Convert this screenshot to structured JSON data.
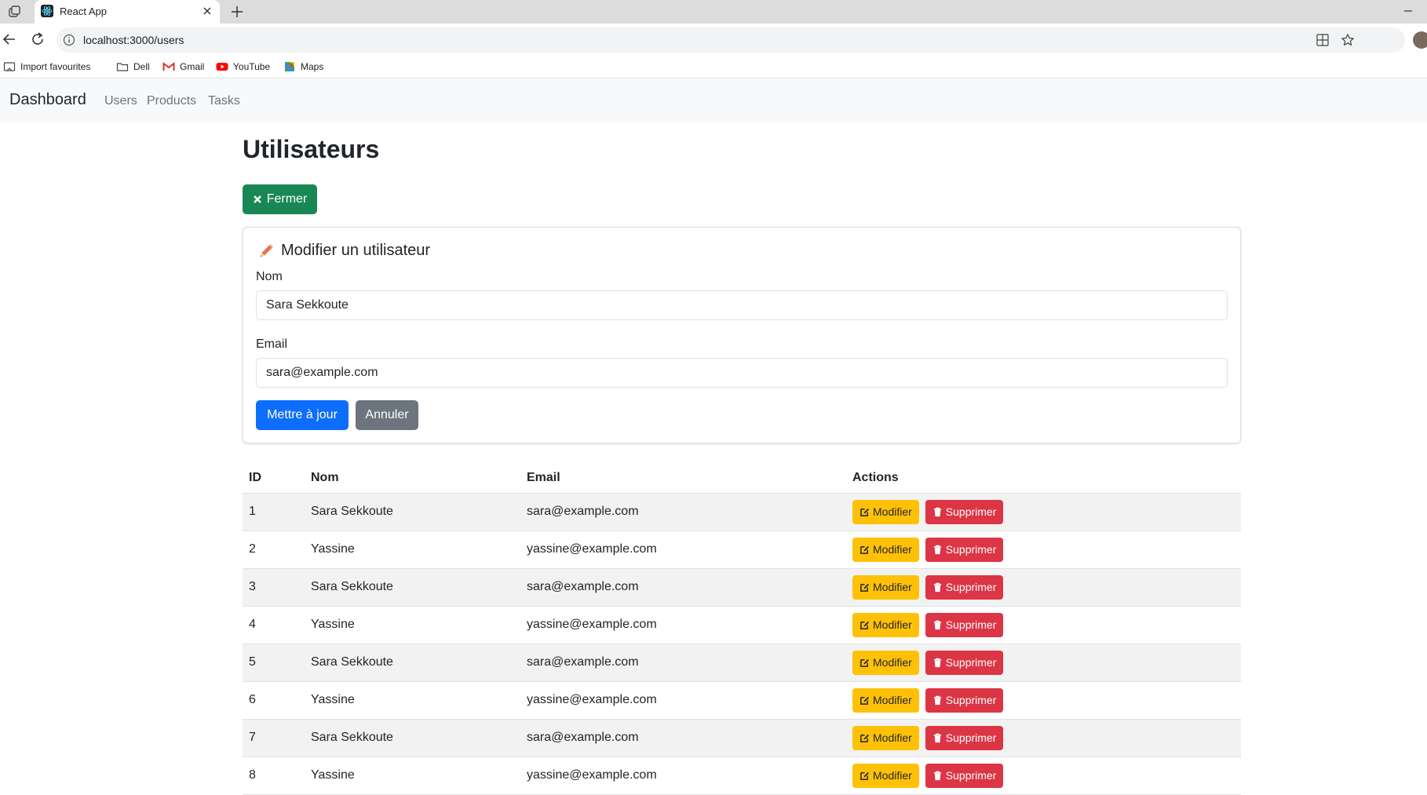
{
  "browser": {
    "tab_title": "React App",
    "url": "localhost:3000/users",
    "bookmarks": [
      "Import favourites",
      "Dell",
      "Gmail",
      "YouTube",
      "Maps"
    ]
  },
  "navbar": {
    "brand": "Dashboard",
    "links": [
      "Users",
      "Products",
      "Tasks"
    ]
  },
  "page": {
    "title": "Utilisateurs",
    "close_button": "Fermer"
  },
  "form": {
    "title": "Modifier un utilisateur",
    "name_label": "Nom",
    "name_value": "Sara Sekkoute",
    "email_label": "Email",
    "email_value": "sara@example.com",
    "submit_label": "Mettre à jour",
    "cancel_label": "Annuler"
  },
  "table": {
    "headers": [
      "ID",
      "Nom",
      "Email",
      "Actions"
    ],
    "edit_label": "Modifier",
    "delete_label": "Supprimer",
    "rows": [
      {
        "id": "1",
        "name": "Sara Sekkoute",
        "email": "sara@example.com"
      },
      {
        "id": "2",
        "name": "Yassine",
        "email": "yassine@example.com"
      },
      {
        "id": "3",
        "name": "Sara Sekkoute",
        "email": "sara@example.com"
      },
      {
        "id": "4",
        "name": "Yassine",
        "email": "yassine@example.com"
      },
      {
        "id": "5",
        "name": "Sara Sekkoute",
        "email": "sara@example.com"
      },
      {
        "id": "6",
        "name": "Yassine",
        "email": "yassine@example.com"
      },
      {
        "id": "7",
        "name": "Sara Sekkoute",
        "email": "sara@example.com"
      },
      {
        "id": "8",
        "name": "Yassine",
        "email": "yassine@example.com"
      }
    ]
  },
  "colors": {
    "success": "#198754",
    "primary": "#0d6efd",
    "secondary": "#6c757d",
    "warning": "#ffc107",
    "danger": "#dc3545",
    "pencil_icon": "#e8734a"
  }
}
